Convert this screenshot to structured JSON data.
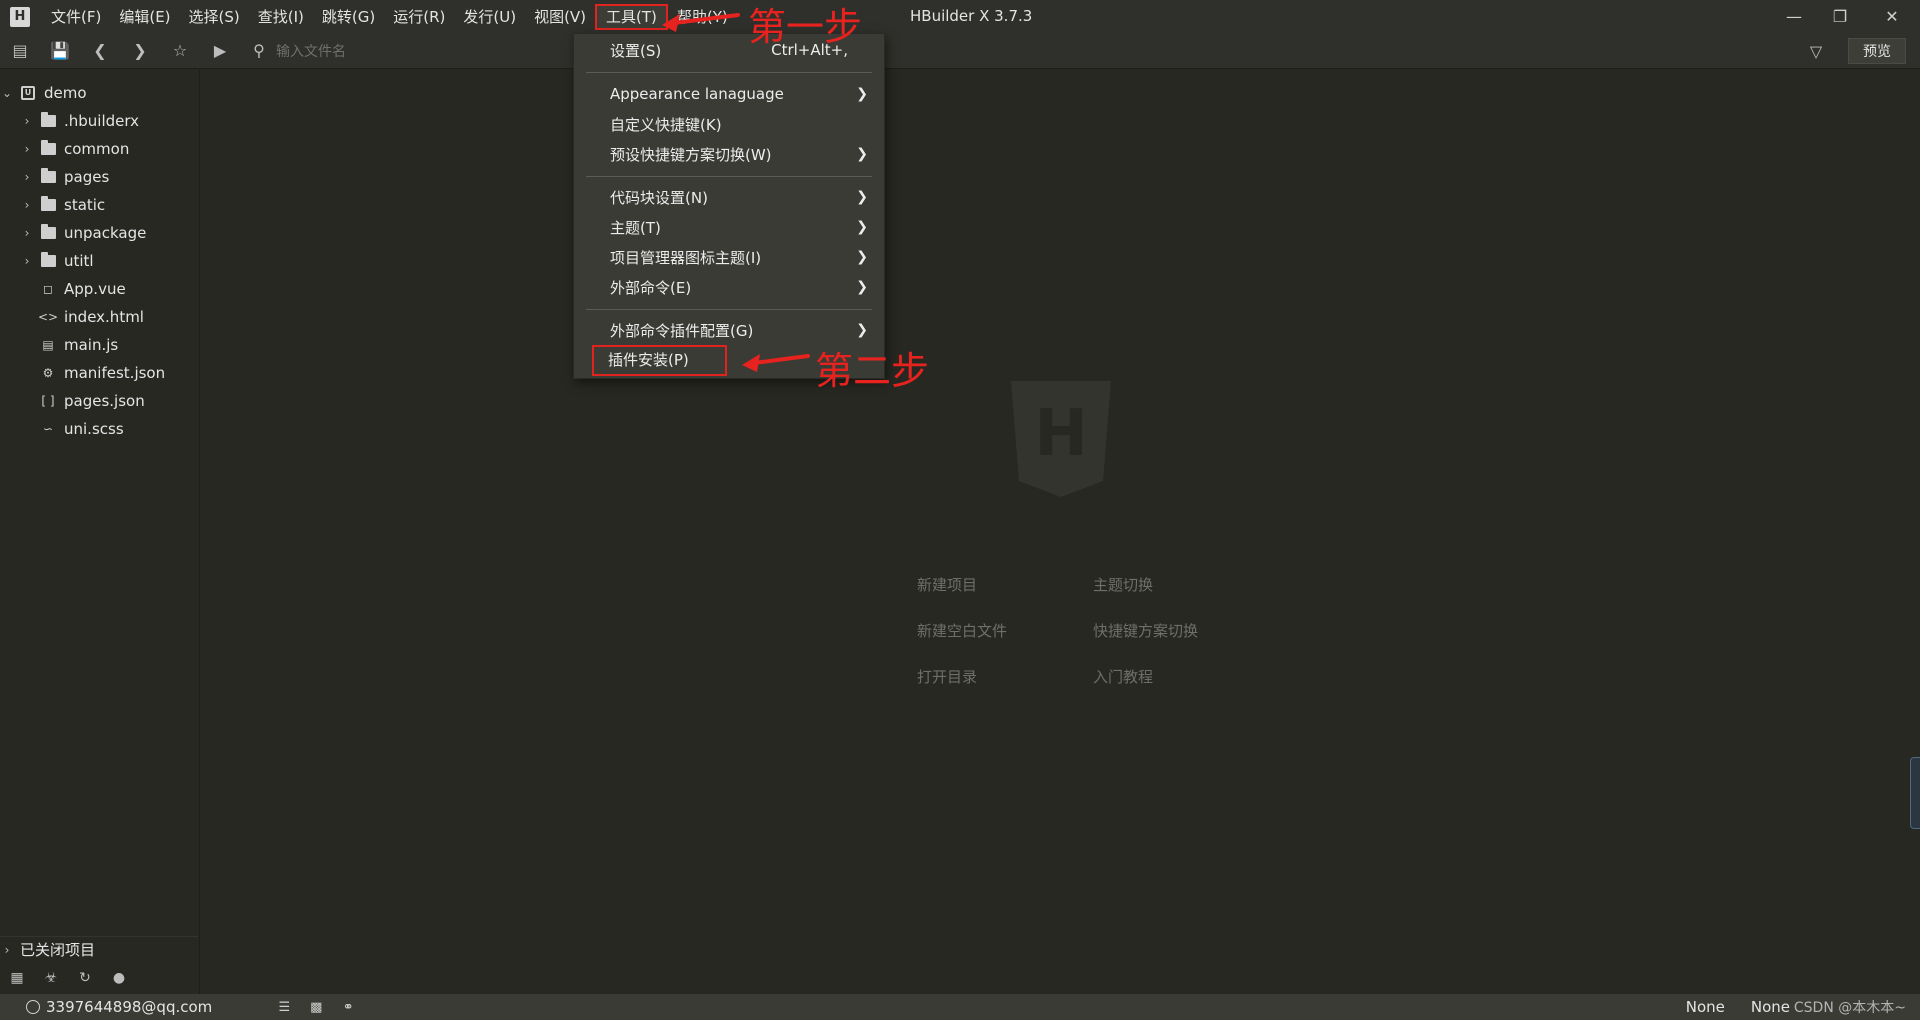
{
  "app": {
    "logo": "H",
    "title": "HBuilder X 3.7.3"
  },
  "menubar": {
    "items": [
      "文件(F)",
      "编辑(E)",
      "选择(S)",
      "查找(I)",
      "跳转(G)",
      "运行(R)",
      "发行(U)",
      "视图(V)",
      "工具(T)",
      "帮助(Y)"
    ]
  },
  "toolbar": {
    "search_placeholder": "输入文件名",
    "preview_label": "预览"
  },
  "sidebar": {
    "project": "demo",
    "items": [
      ".hbuilderx",
      "common",
      "pages",
      "static",
      "unpackage",
      "utitl",
      "App.vue",
      "index.html",
      "main.js",
      "manifest.json",
      "pages.json",
      "uni.scss"
    ],
    "closed_projects": "已关闭项目"
  },
  "dropdown": {
    "settings": "设置(S)",
    "settings_shortcut": "Ctrl+Alt+,",
    "appearance": "Appearance lanaguage",
    "custom_shortcuts": "自定义快捷键(K)",
    "preset_shortcuts": "预设快捷键方案切换(W)",
    "snippets": "代码块设置(N)",
    "theme": "主题(T)",
    "icon_theme": "项目管理器图标主题(I)",
    "external_cmd": "外部命令(E)",
    "external_cmd_plugin": "外部命令插件配置(G)",
    "plugin_install": "插件安装(P)"
  },
  "welcome": {
    "logo": "H",
    "new_project": "新建项目",
    "new_blank_file": "新建空白文件",
    "open_dir": "打开目录",
    "switch_theme": "主题切换",
    "switch_keymap": "快捷键方案切换",
    "tutorial": "入门教程"
  },
  "annotations": {
    "step1": "第一步",
    "step2": "第二步"
  },
  "statusbar": {
    "user": "3397644898@qq.com",
    "none1": "None",
    "none2": "None",
    "watermark": "CSDN @本木本~"
  },
  "colors": {
    "background": "#272822",
    "chrome": "#2f302b",
    "menu": "#3a3b35",
    "annotation": "#e0231f"
  }
}
